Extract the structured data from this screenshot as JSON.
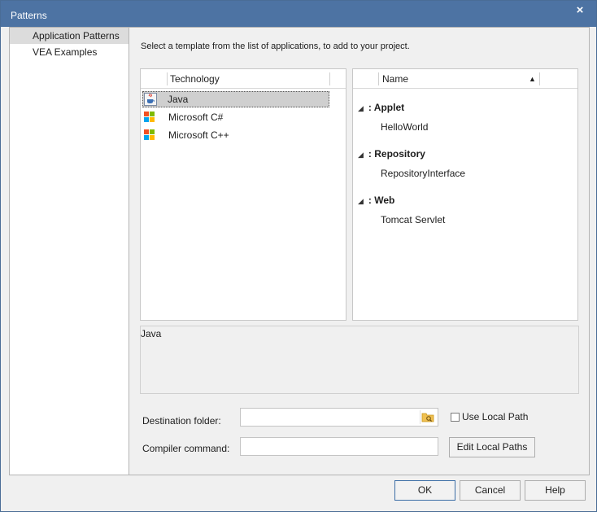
{
  "window": {
    "title": "Patterns",
    "close_glyph": "×"
  },
  "sidebar": {
    "items": [
      {
        "label": "Application Patterns",
        "selected": true
      },
      {
        "label": "VEA Examples",
        "selected": false
      }
    ]
  },
  "main": {
    "instruction": "Select a template from the list of applications, to add to your project.",
    "technology_list": {
      "header": "Technology",
      "items": [
        {
          "label": "Java",
          "icon": "java-icon",
          "selected": true
        },
        {
          "label": "Microsoft C#",
          "icon": "windows-logo-icon",
          "selected": false
        },
        {
          "label": "Microsoft C++",
          "icon": "windows-logo-icon",
          "selected": false
        }
      ]
    },
    "pattern_list": {
      "header": "Name",
      "sort": "ascending",
      "groups": [
        {
          "name": ": Applet",
          "items": [
            "HelloWorld"
          ]
        },
        {
          "name": ": Repository",
          "items": [
            "RepositoryInterface"
          ]
        },
        {
          "name": ": Web",
          "items": [
            "Tomcat Servlet"
          ]
        }
      ]
    },
    "description": "Java",
    "destination_folder": {
      "label": "Destination folder:",
      "value": ""
    },
    "use_local_path": {
      "label": "Use Local Path",
      "checked": false
    },
    "compiler_command": {
      "label": "Compiler command:",
      "value": ""
    },
    "edit_local_paths_label": "Edit Local Paths"
  },
  "footer": {
    "ok_label": "OK",
    "cancel_label": "Cancel",
    "help_label": "Help"
  },
  "colors": {
    "titlebar": "#4d73a3",
    "selection": "#cfcfcf",
    "default_button_border": "#3c6ea6"
  }
}
